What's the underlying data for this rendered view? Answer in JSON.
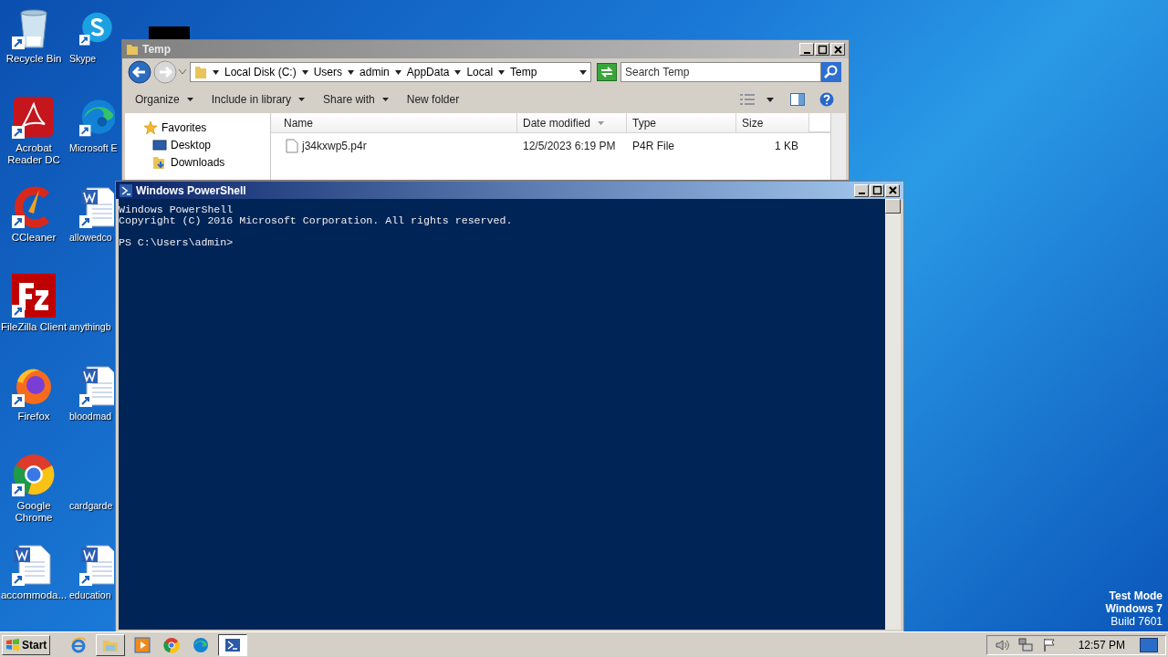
{
  "desktop_icon_columns": [
    [
      {
        "label": "Recycle Bin",
        "kind": "recycle"
      },
      {
        "label": "Acrobat Reader DC",
        "kind": "acrobat"
      },
      {
        "label": "CCleaner",
        "kind": "ccleaner"
      },
      {
        "label": "FileZilla Client",
        "kind": "filezilla"
      },
      {
        "label": "Firefox",
        "kind": "firefox"
      },
      {
        "label": "Google Chrome",
        "kind": "chrome"
      },
      {
        "label": "accommoda...",
        "kind": "word"
      }
    ],
    [
      {
        "label": "Skype",
        "kind": "skype"
      },
      {
        "label": "Microsoft E",
        "kind": "edge"
      },
      {
        "label": "allowedco",
        "kind": "word"
      },
      {
        "label": "anythingb",
        "kind": "blank"
      },
      {
        "label": "bloodmad",
        "kind": "word"
      },
      {
        "label": "cardgarde",
        "kind": "blank"
      },
      {
        "label": "education",
        "kind": "word"
      }
    ]
  ],
  "explorer": {
    "title": "Temp",
    "breadcrumb": [
      "Local Disk (C:)",
      "Users",
      "admin",
      "AppData",
      "Local",
      "Temp"
    ],
    "search": {
      "placeholder": "Search Temp"
    },
    "toolbar": [
      {
        "label": "Organize",
        "dropdown": true
      },
      {
        "label": "Include in library",
        "dropdown": true
      },
      {
        "label": "Share with",
        "dropdown": true
      },
      {
        "label": "New folder",
        "dropdown": false
      }
    ],
    "nav": [
      {
        "label": "Favorites",
        "kind": "star"
      },
      {
        "label": "Desktop",
        "kind": "desktop"
      },
      {
        "label": "Downloads",
        "kind": "downloads"
      }
    ],
    "columns": [
      {
        "label": "Name",
        "sorted": false
      },
      {
        "label": "Date modified",
        "sorted": true
      },
      {
        "label": "Type",
        "sorted": false
      },
      {
        "label": "Size",
        "sorted": false
      }
    ],
    "rows": [
      [
        "j34kxwp5.p4r",
        "12/5/2023 6:19 PM",
        "P4R File",
        "1 KB"
      ]
    ]
  },
  "powershell": {
    "title": "Windows PowerShell",
    "banner": [
      "Windows PowerShell",
      "Copyright (C) 2016 Microsoft Corporation. All rights reserved."
    ],
    "prompt": "PS C:\\Users\\admin>"
  },
  "system_info": [
    "Test Mode",
    "Windows 7",
    "Build 7601"
  ],
  "taskbar": {
    "start": "Start",
    "apps": [
      {
        "kind": "ie",
        "running": false,
        "selected": false
      },
      {
        "kind": "explorer",
        "running": true,
        "selected": false
      },
      {
        "kind": "media",
        "running": false,
        "selected": false
      },
      {
        "kind": "chrome",
        "running": false,
        "selected": false
      },
      {
        "kind": "edge",
        "running": false,
        "selected": false
      },
      {
        "kind": "powershell",
        "running": true,
        "selected": true
      }
    ],
    "clock": "12:57 PM"
  }
}
